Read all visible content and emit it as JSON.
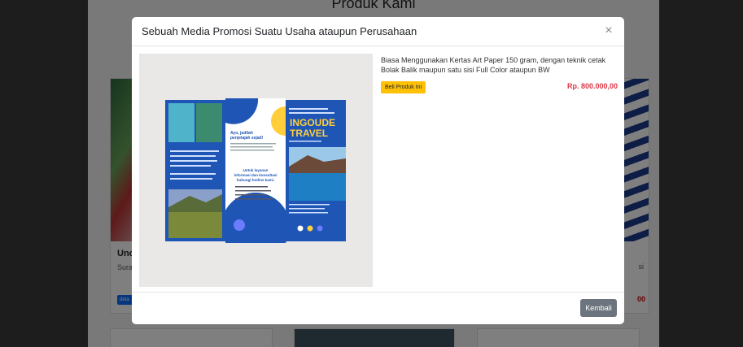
{
  "background": {
    "section_title": "Produk Kami",
    "left_card": {
      "title": "Unc",
      "text": "Surat Perm",
      "button": "deta"
    },
    "right_card": {
      "text": "si",
      "price": "00"
    }
  },
  "modal": {
    "title": "Sebuah Media Promosi Suatu Usaha ataupun Perusahaan",
    "close_icon": "×",
    "description": "Biasa Menggunakan Kertas Art Paper 150 gram, dengan teknik cetak Bolak Balik maupun satu sisi Full Color ataupun BW",
    "buy_button": "Beli Produk Ini",
    "price": "Rp. 800.000,00",
    "back_button": "Kembali"
  },
  "brochure": {
    "headline": "INGOUDE",
    "headline2": "TRAVEL",
    "subhead": "Ayo, jadilah",
    "subhead2": "penjelajah sejati!",
    "contact_title": "Untuk layanan",
    "contact_title2": "informasi dan konsultasi",
    "contact_title3": "hubungi hotline kami."
  },
  "colors": {
    "accent_yellow": "#ffc107",
    "price_red": "#dc3545",
    "brochure_blue": "#1f55b5",
    "back_gray": "#6c757d"
  }
}
